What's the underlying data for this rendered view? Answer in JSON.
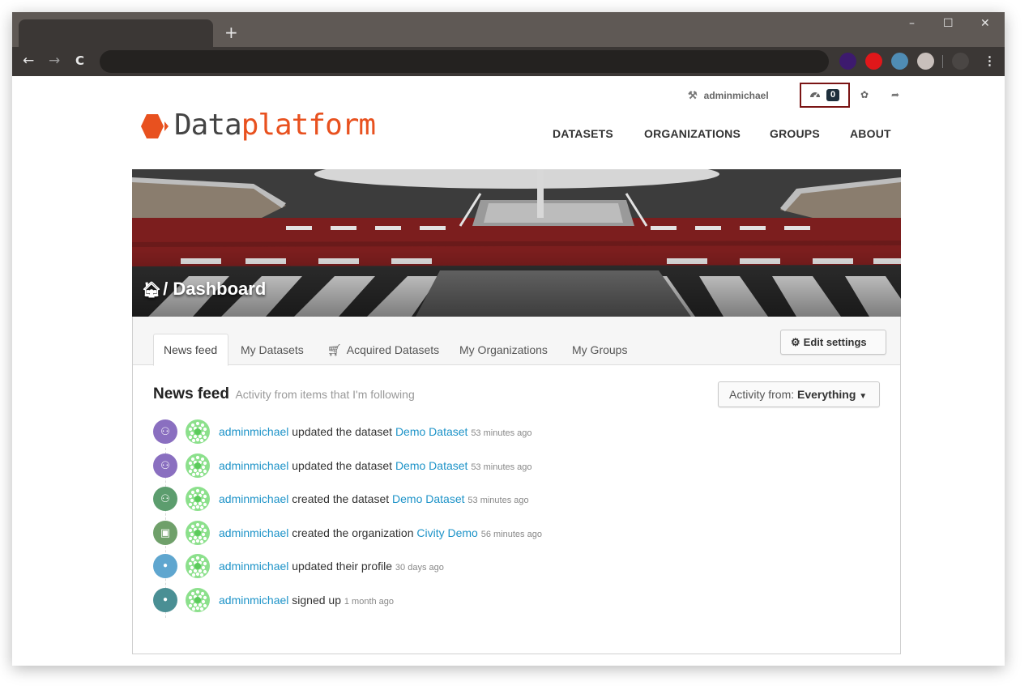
{
  "browser": {
    "new_tab_symbol": "+",
    "window_controls": {
      "minimize": "–",
      "maximize": "☐",
      "close": "✕"
    },
    "nav": {
      "back": "←",
      "forward": "→",
      "reload": "C"
    },
    "kebab": "⋮",
    "extension_colors": [
      "#3d1a6e",
      "#e0171a",
      "#4f8cb4",
      "#c8bfbb",
      "#4a4644"
    ]
  },
  "header": {
    "username": "adminmichael",
    "notification_count": "0",
    "logo_part1": "Data",
    "logo_part2": "platform",
    "nav": [
      "DATASETS",
      "ORGANIZATIONS",
      "GROUPS",
      "ABOUT"
    ]
  },
  "hero": {
    "title": "/ Dashboard"
  },
  "tabs": {
    "items": [
      "News feed",
      "My Datasets",
      "Acquired Datasets",
      "My Organizations",
      "My Groups"
    ],
    "edit_settings": "Edit settings"
  },
  "feed": {
    "heading": "News feed",
    "subheading": "Activity from items that I'm following",
    "activity_from_label": "Activity from:",
    "activity_from_value": "Everything",
    "items": [
      {
        "user": "adminmichael",
        "action": "updated the dataset",
        "link": "Demo Dataset",
        "time": "53 minutes ago",
        "icon": "sitemap-icon",
        "color": "#8a6fc0"
      },
      {
        "user": "adminmichael",
        "action": "updated the dataset",
        "link": "Demo Dataset",
        "time": "53 minutes ago",
        "icon": "sitemap-icon",
        "color": "#8a6fc0"
      },
      {
        "user": "adminmichael",
        "action": "created the dataset",
        "link": "Demo Dataset",
        "time": "53 minutes ago",
        "icon": "sitemap-icon",
        "color": "#5c9d6e"
      },
      {
        "user": "adminmichael",
        "action": "created the organization",
        "link": "Civity Demo",
        "time": "56 minutes ago",
        "icon": "briefcase-icon",
        "color": "#6fa06a"
      },
      {
        "user": "adminmichael",
        "action": "updated their profile",
        "link": "",
        "time": "30 days ago",
        "icon": "user-icon",
        "color": "#5fa6cf"
      },
      {
        "user": "adminmichael",
        "action": "signed up",
        "link": "",
        "time": "1 month ago",
        "icon": "user-icon",
        "color": "#4a8f94"
      }
    ]
  }
}
